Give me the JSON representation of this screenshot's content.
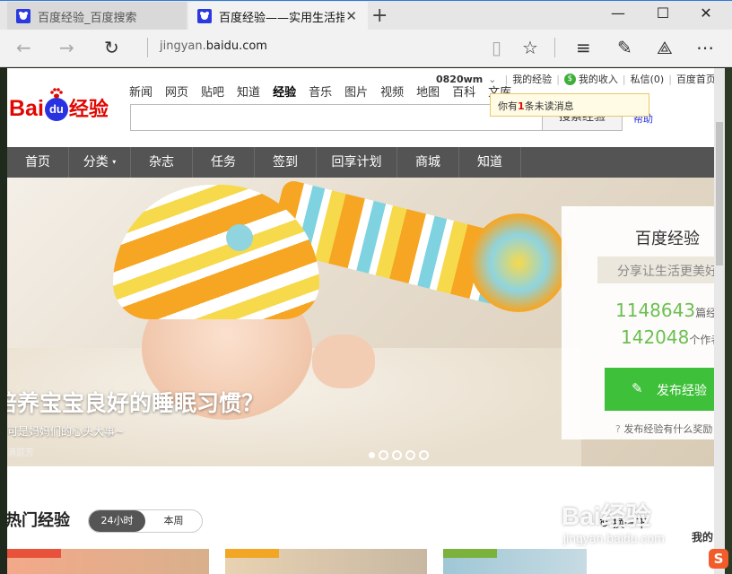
{
  "browser": {
    "tabs": [
      {
        "label": "百度经验_百度搜索",
        "active": false
      },
      {
        "label": "百度经验——实用生活指南",
        "active": true
      }
    ],
    "url_prefix": "jingyan.",
    "url_domain": "baidu.com"
  },
  "site": {
    "logo_bai": "Bai",
    "logo_du": "du",
    "logo_jingyan": "经验",
    "top_nav": [
      "新闻",
      "网页",
      "贴吧",
      "知道",
      "经验",
      "音乐",
      "图片",
      "视频",
      "地图",
      "百科",
      "文库"
    ],
    "top_nav_current": "经验",
    "user": {
      "name": "0820wm",
      "my_exp": "我的经验",
      "my_income": "我的收入",
      "messages": "私信(0)",
      "home": "百度首页"
    },
    "tooltip": {
      "prefix": "你有",
      "count": "1",
      "suffix": "条未读消息"
    },
    "search_button": "搜索经验",
    "help": "帮助",
    "main_nav": [
      "首页",
      "分类",
      "杂志",
      "任务",
      "签到",
      "回享计划",
      "商城",
      "知道"
    ]
  },
  "hero": {
    "title": "培养宝宝良好的睡眠习惯？",
    "subtitle": "可是妈妈们的心头大事~",
    "author": "满庭芳",
    "slide_count": 5,
    "active_slide": 0
  },
  "panel": {
    "title": "百度经验",
    "slogan": "分享让生活更美好",
    "articles_count": "1148643",
    "articles_unit": "篇经验",
    "authors_count": "142048",
    "authors_unit": "个作者",
    "publish_button": "发布经验",
    "help_text": "发布经验有什么奖励"
  },
  "hot": {
    "title": "热门经验",
    "tabs": [
      {
        "label": "24小时",
        "active": true
      },
      {
        "label": "本周",
        "active": false
      }
    ],
    "next_label": "换一下"
  },
  "watermark": {
    "brand": "Bai经验",
    "url": "jingyan.baidu.com",
    "side_text": "我的"
  }
}
